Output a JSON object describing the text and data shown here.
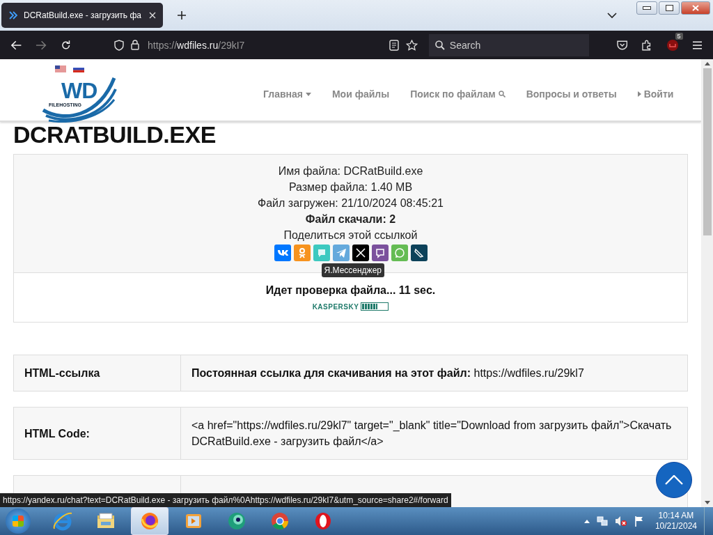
{
  "browser": {
    "tab": {
      "title": "DCRatBuild.exe - загрузить фа",
      "selected": true
    },
    "url_scheme": "https://",
    "url_host": "wdfiles.ru",
    "url_path": "/29kI7",
    "search_placeholder": "Search",
    "extension_badge": "5"
  },
  "site": {
    "flags": [
      {
        "kind": "us"
      },
      {
        "kind": "ru"
      }
    ],
    "logo_text": "WD",
    "logo_sub": "FILEHOSTING",
    "nav": [
      {
        "label": "Главная",
        "kind": "dropdown"
      },
      {
        "label": "Мои файлы",
        "kind": "plain"
      },
      {
        "label": "Поиск по файлам",
        "kind": "search"
      },
      {
        "label": "Вопросы и ответы",
        "kind": "plain"
      },
      {
        "label": "Войти",
        "kind": "login"
      }
    ]
  },
  "file": {
    "title": "DCRATBUILD.EXE",
    "info": [
      {
        "text": "Имя файла: DCRatBuild.exe",
        "bold": false
      },
      {
        "text": "Размер файла: 1.40 MB",
        "bold": false
      },
      {
        "text": "Файл загружен: 21/10/2024 08:45:21",
        "bold": false
      },
      {
        "text": "Файл скачали: 2",
        "bold": true
      },
      {
        "text": "Поделиться этой ссылкой",
        "bold": false
      }
    ],
    "share": [
      {
        "kind": "vk",
        "color": "#0077ff"
      },
      {
        "kind": "ok",
        "color": "#f7931e"
      },
      {
        "kind": "yandex",
        "color": "#3dc9c0"
      },
      {
        "kind": "telegram",
        "color": "#64a9dc"
      },
      {
        "kind": "x",
        "color": "#000000"
      },
      {
        "kind": "viber",
        "color": "#7b519d"
      },
      {
        "kind": "whatsapp",
        "color": "#65bc54"
      },
      {
        "kind": "livejournal",
        "color": "#0d425a"
      }
    ],
    "tooltip": "Я.Мессенджер",
    "check_text": "Идет проверка файла... 11 sec.",
    "av": {
      "name": "KASPERSKY",
      "level": 0.6
    }
  },
  "links": [
    {
      "label": "HTML-ссылка",
      "value": "**Постоянная ссылка для скачивания на этот файл:** https://wdfiles.ru/29kl7"
    },
    {
      "label": "HTML Code:",
      "value": "<a href=\"https://wdfiles.ru/29kl7\" target=\"_blank\" title=\"Download from загрузить файл\">Скачать DCRatBuild.exe - загрузить файл</a>"
    }
  ],
  "status_link": "https://yandex.ru/chat?text=DCRatBuild.exe - загрузить файл%0Ahttps://wdfiles.ru/29kI7&utm_source=share2#/forward",
  "taskbar": {
    "apps": [
      {
        "kind": "ie",
        "selected": false
      },
      {
        "kind": "explorer",
        "selected": false
      },
      {
        "kind": "firefox",
        "selected": true
      },
      {
        "kind": "media",
        "selected": false
      },
      {
        "kind": "green",
        "selected": false
      },
      {
        "kind": "chrome",
        "selected": false
      },
      {
        "kind": "opera",
        "selected": false
      }
    ],
    "time": "10:14 AM",
    "date": "10/21/2024"
  }
}
